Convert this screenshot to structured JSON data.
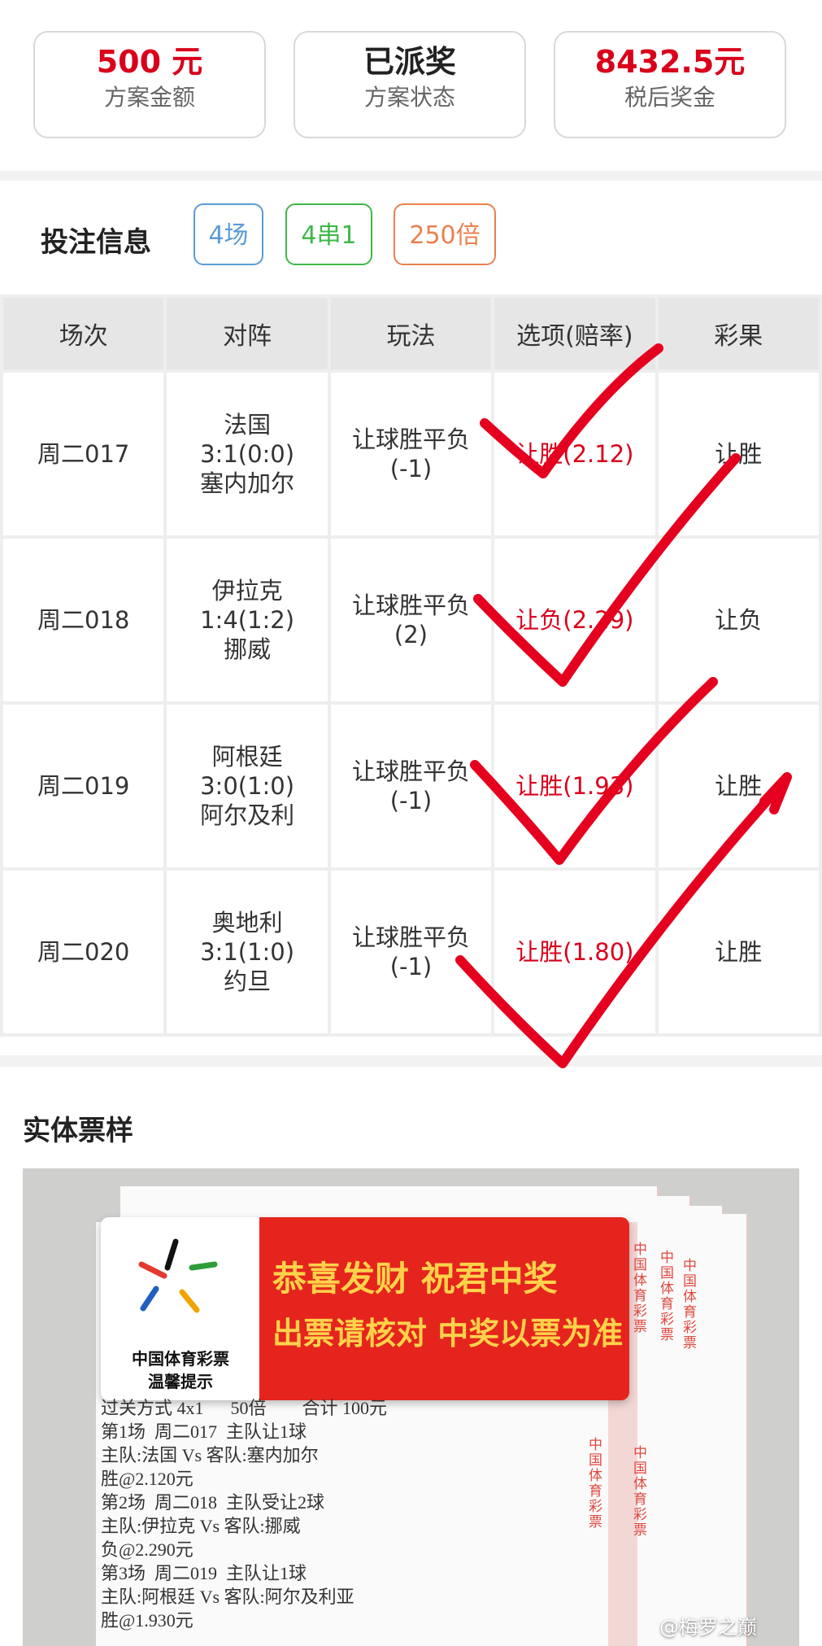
{
  "summary": {
    "cards": [
      {
        "value": "500 元",
        "label": "方案金额"
      },
      {
        "value": "已派奖",
        "label": "方案状态"
      },
      {
        "value": "8432.5元",
        "label": "税后奖金"
      }
    ]
  },
  "bet_info": {
    "title": "投注信息",
    "tags": {
      "matches": "4场",
      "pass": "4串1",
      "multiple": "250倍"
    },
    "columns": [
      "场次",
      "对阵",
      "玩法",
      "选项(赔率)",
      "彩果"
    ],
    "rows": [
      {
        "id": "周二017",
        "home": "法国",
        "score": "3:1(0:0)",
        "away": "塞内加尔",
        "play": "让球胜平负",
        "handicap": "(-1)",
        "option": "让胜(2.12)",
        "result": "让胜"
      },
      {
        "id": "周二018",
        "home": "伊拉克",
        "score": "1:4(1:2)",
        "away": "挪威",
        "play": "让球胜平负",
        "handicap": "(2)",
        "option": "让负(2.29)",
        "result": "让负"
      },
      {
        "id": "周二019",
        "home": "阿根廷",
        "score": "3:0(1:0)",
        "away": "阿尔及利",
        "play": "让球胜平负",
        "handicap": "(-1)",
        "option": "让胜(1.93)",
        "result": "让胜"
      },
      {
        "id": "周二020",
        "home": "奥地利",
        "score": "3:1(1:0)",
        "away": "约旦",
        "play": "让球胜平负",
        "handicap": "(-1)",
        "option": "让胜(1.80)",
        "result": "让胜"
      }
    ]
  },
  "ticket": {
    "title": "实体票样",
    "plaque_line1": "恭喜发财 祝君中奖",
    "plaque_line2": "出票请核对 中奖以票为准",
    "brand_line1": "中国体育彩票",
    "brand_line2": "温馨提示",
    "strip_text": "中国体育彩票",
    "receipt_lines": [
      "过关方式 4x1      50倍        合计 100元",
      "第1场  周二017  主队让1球",
      "主队:法国 Vs 客队:塞内加尔",
      "胜@2.120元",
      "第2场  周二018  主队受让2球",
      "主队:伊拉克 Vs 客队:挪威",
      "负@2.290元",
      "第3场  周二019  主队让1球",
      "主队:阿根廷 Vs 客队:阿尔及利亚",
      "胜@1.930元"
    ],
    "watermark": "@梅罗之巅"
  },
  "colors": {
    "accent_red": "#d9001b",
    "tag_blue": "#5b9bd5",
    "tag_green": "#3fb84a",
    "tag_orange": "#e9814f",
    "check_red": "#e4001e"
  }
}
